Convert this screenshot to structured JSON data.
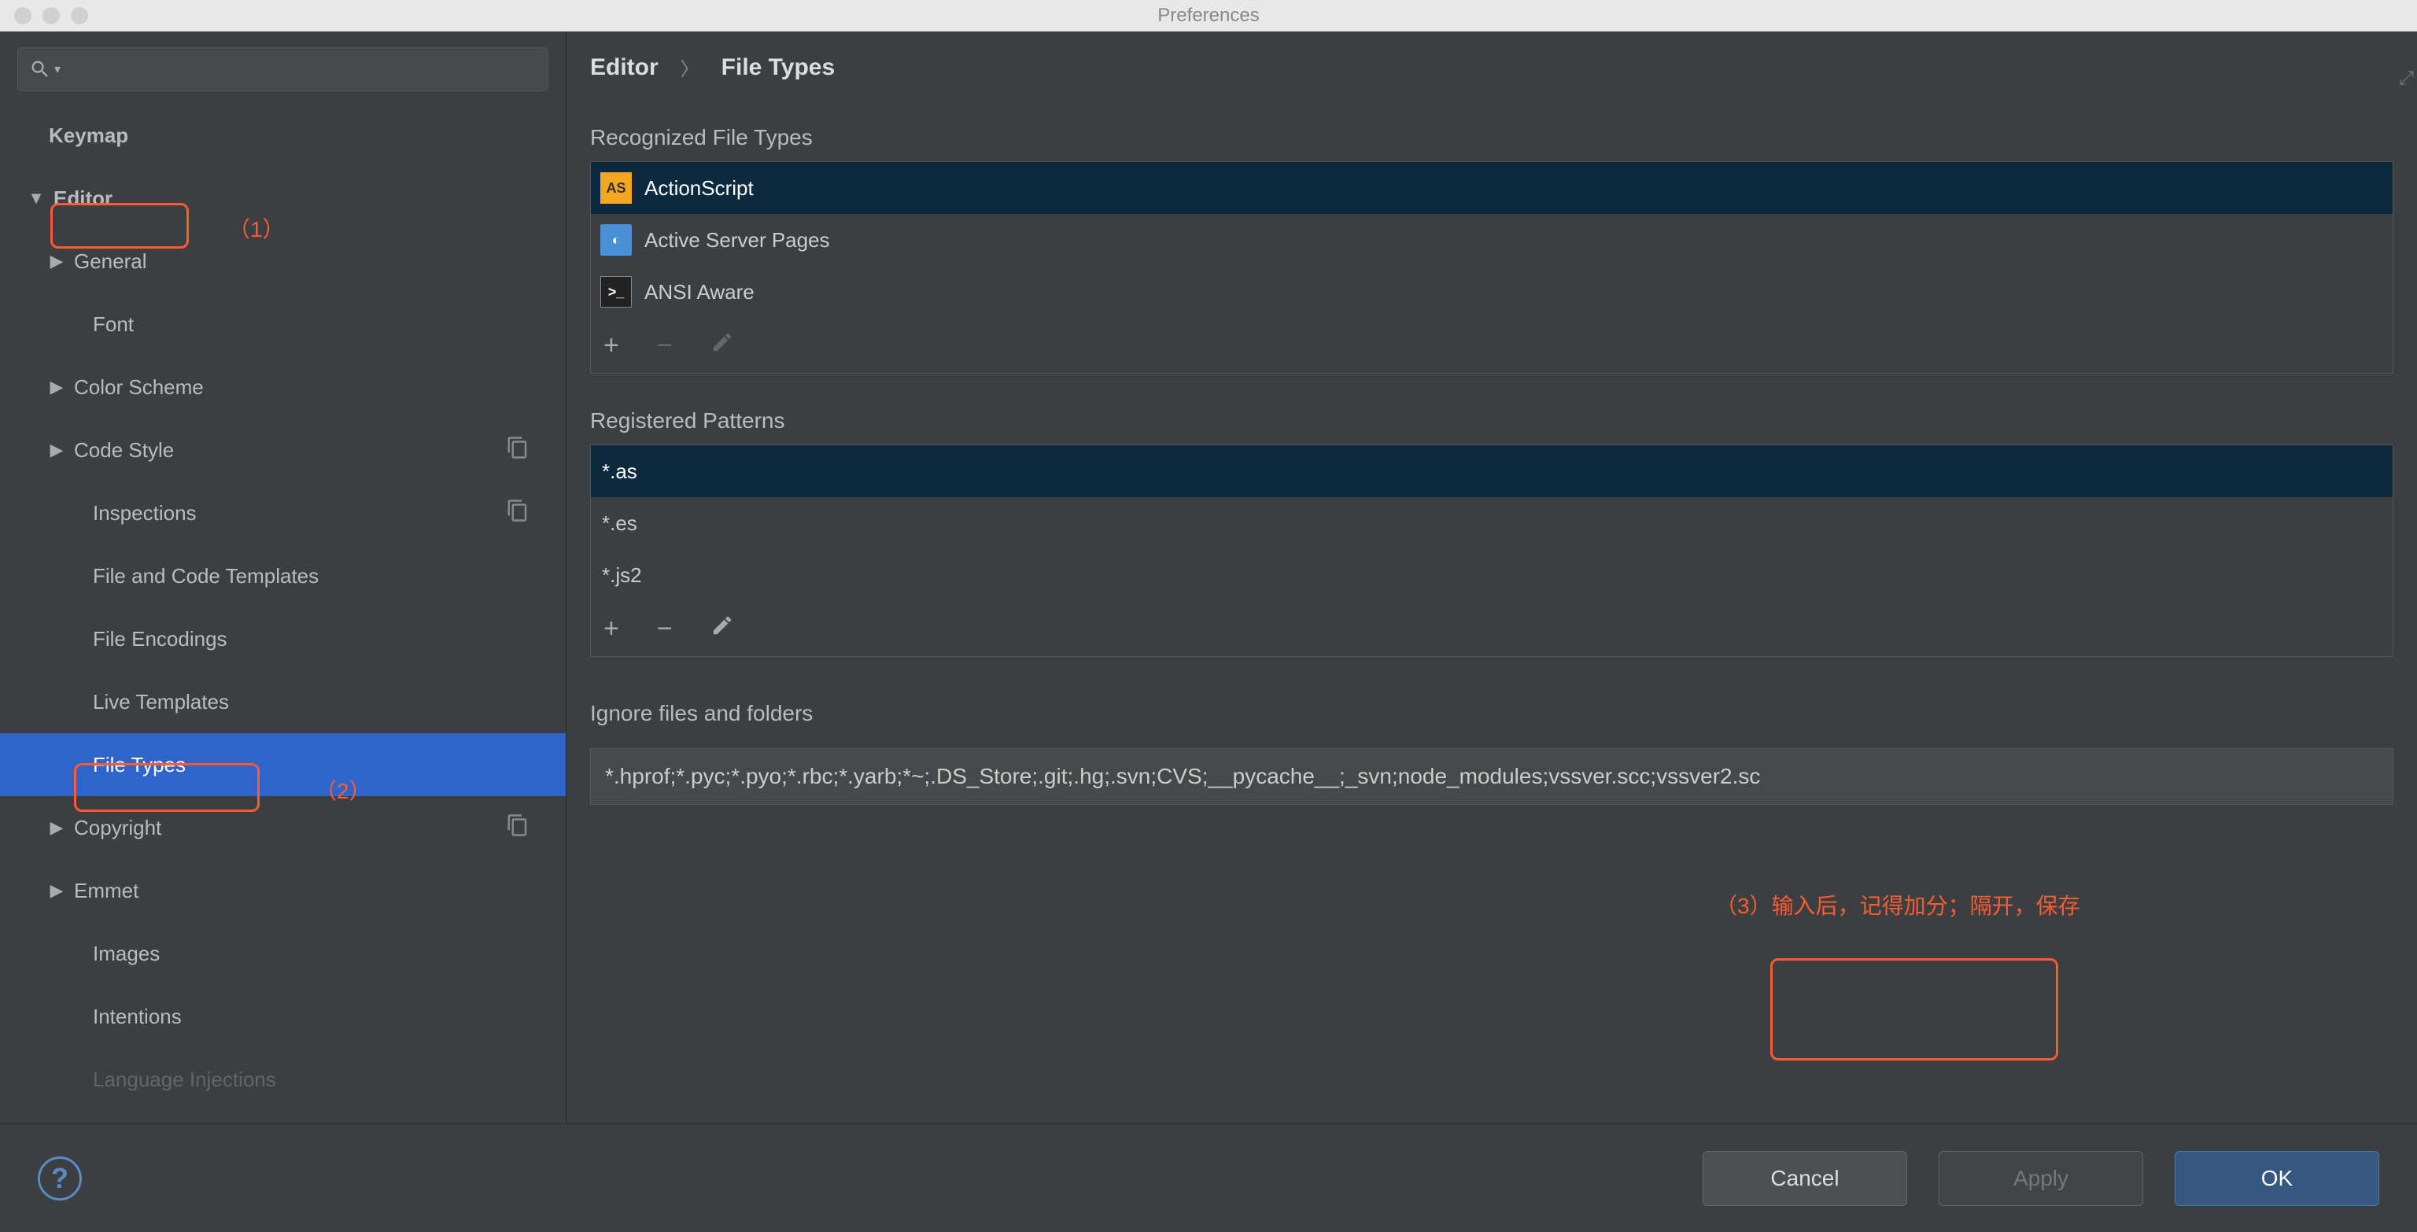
{
  "window": {
    "title": "Preferences"
  },
  "sidebar": {
    "keymap": "Keymap",
    "editor": "Editor",
    "general": "General",
    "font": "Font",
    "color_scheme": "Color Scheme",
    "code_style": "Code Style",
    "inspections": "Inspections",
    "file_code_templates": "File and Code Templates",
    "file_encodings": "File Encodings",
    "live_templates": "Live Templates",
    "file_types": "File Types",
    "copyright": "Copyright",
    "emmet": "Emmet",
    "images": "Images",
    "intentions": "Intentions",
    "lang_injections": "Language Injections"
  },
  "annotations": {
    "a1": "（1）",
    "a2": "（2）",
    "a3": "（3）输入后，记得加分；隔开，保存"
  },
  "breadcrumb": {
    "editor": "Editor",
    "file_types": "File Types"
  },
  "sections": {
    "recognized": "Recognized File Types",
    "patterns": "Registered Patterns",
    "ignore": "Ignore files and folders"
  },
  "file_types_list": [
    {
      "label": "ActionScript"
    },
    {
      "label": "Active Server Pages"
    },
    {
      "label": "ANSI Aware"
    }
  ],
  "patterns_list": [
    {
      "label": "*.as"
    },
    {
      "label": "*.es"
    },
    {
      "label": "*.js2"
    }
  ],
  "ignore_value": "*.hprof;*.pyc;*.pyo;*.rbc;*.yarb;*~;.DS_Store;.git;.hg;.svn;CVS;__pycache__;_svn;node_modules;vssver.scc;vssver2.sc",
  "buttons": {
    "cancel": "Cancel",
    "apply": "Apply",
    "ok": "OK"
  }
}
